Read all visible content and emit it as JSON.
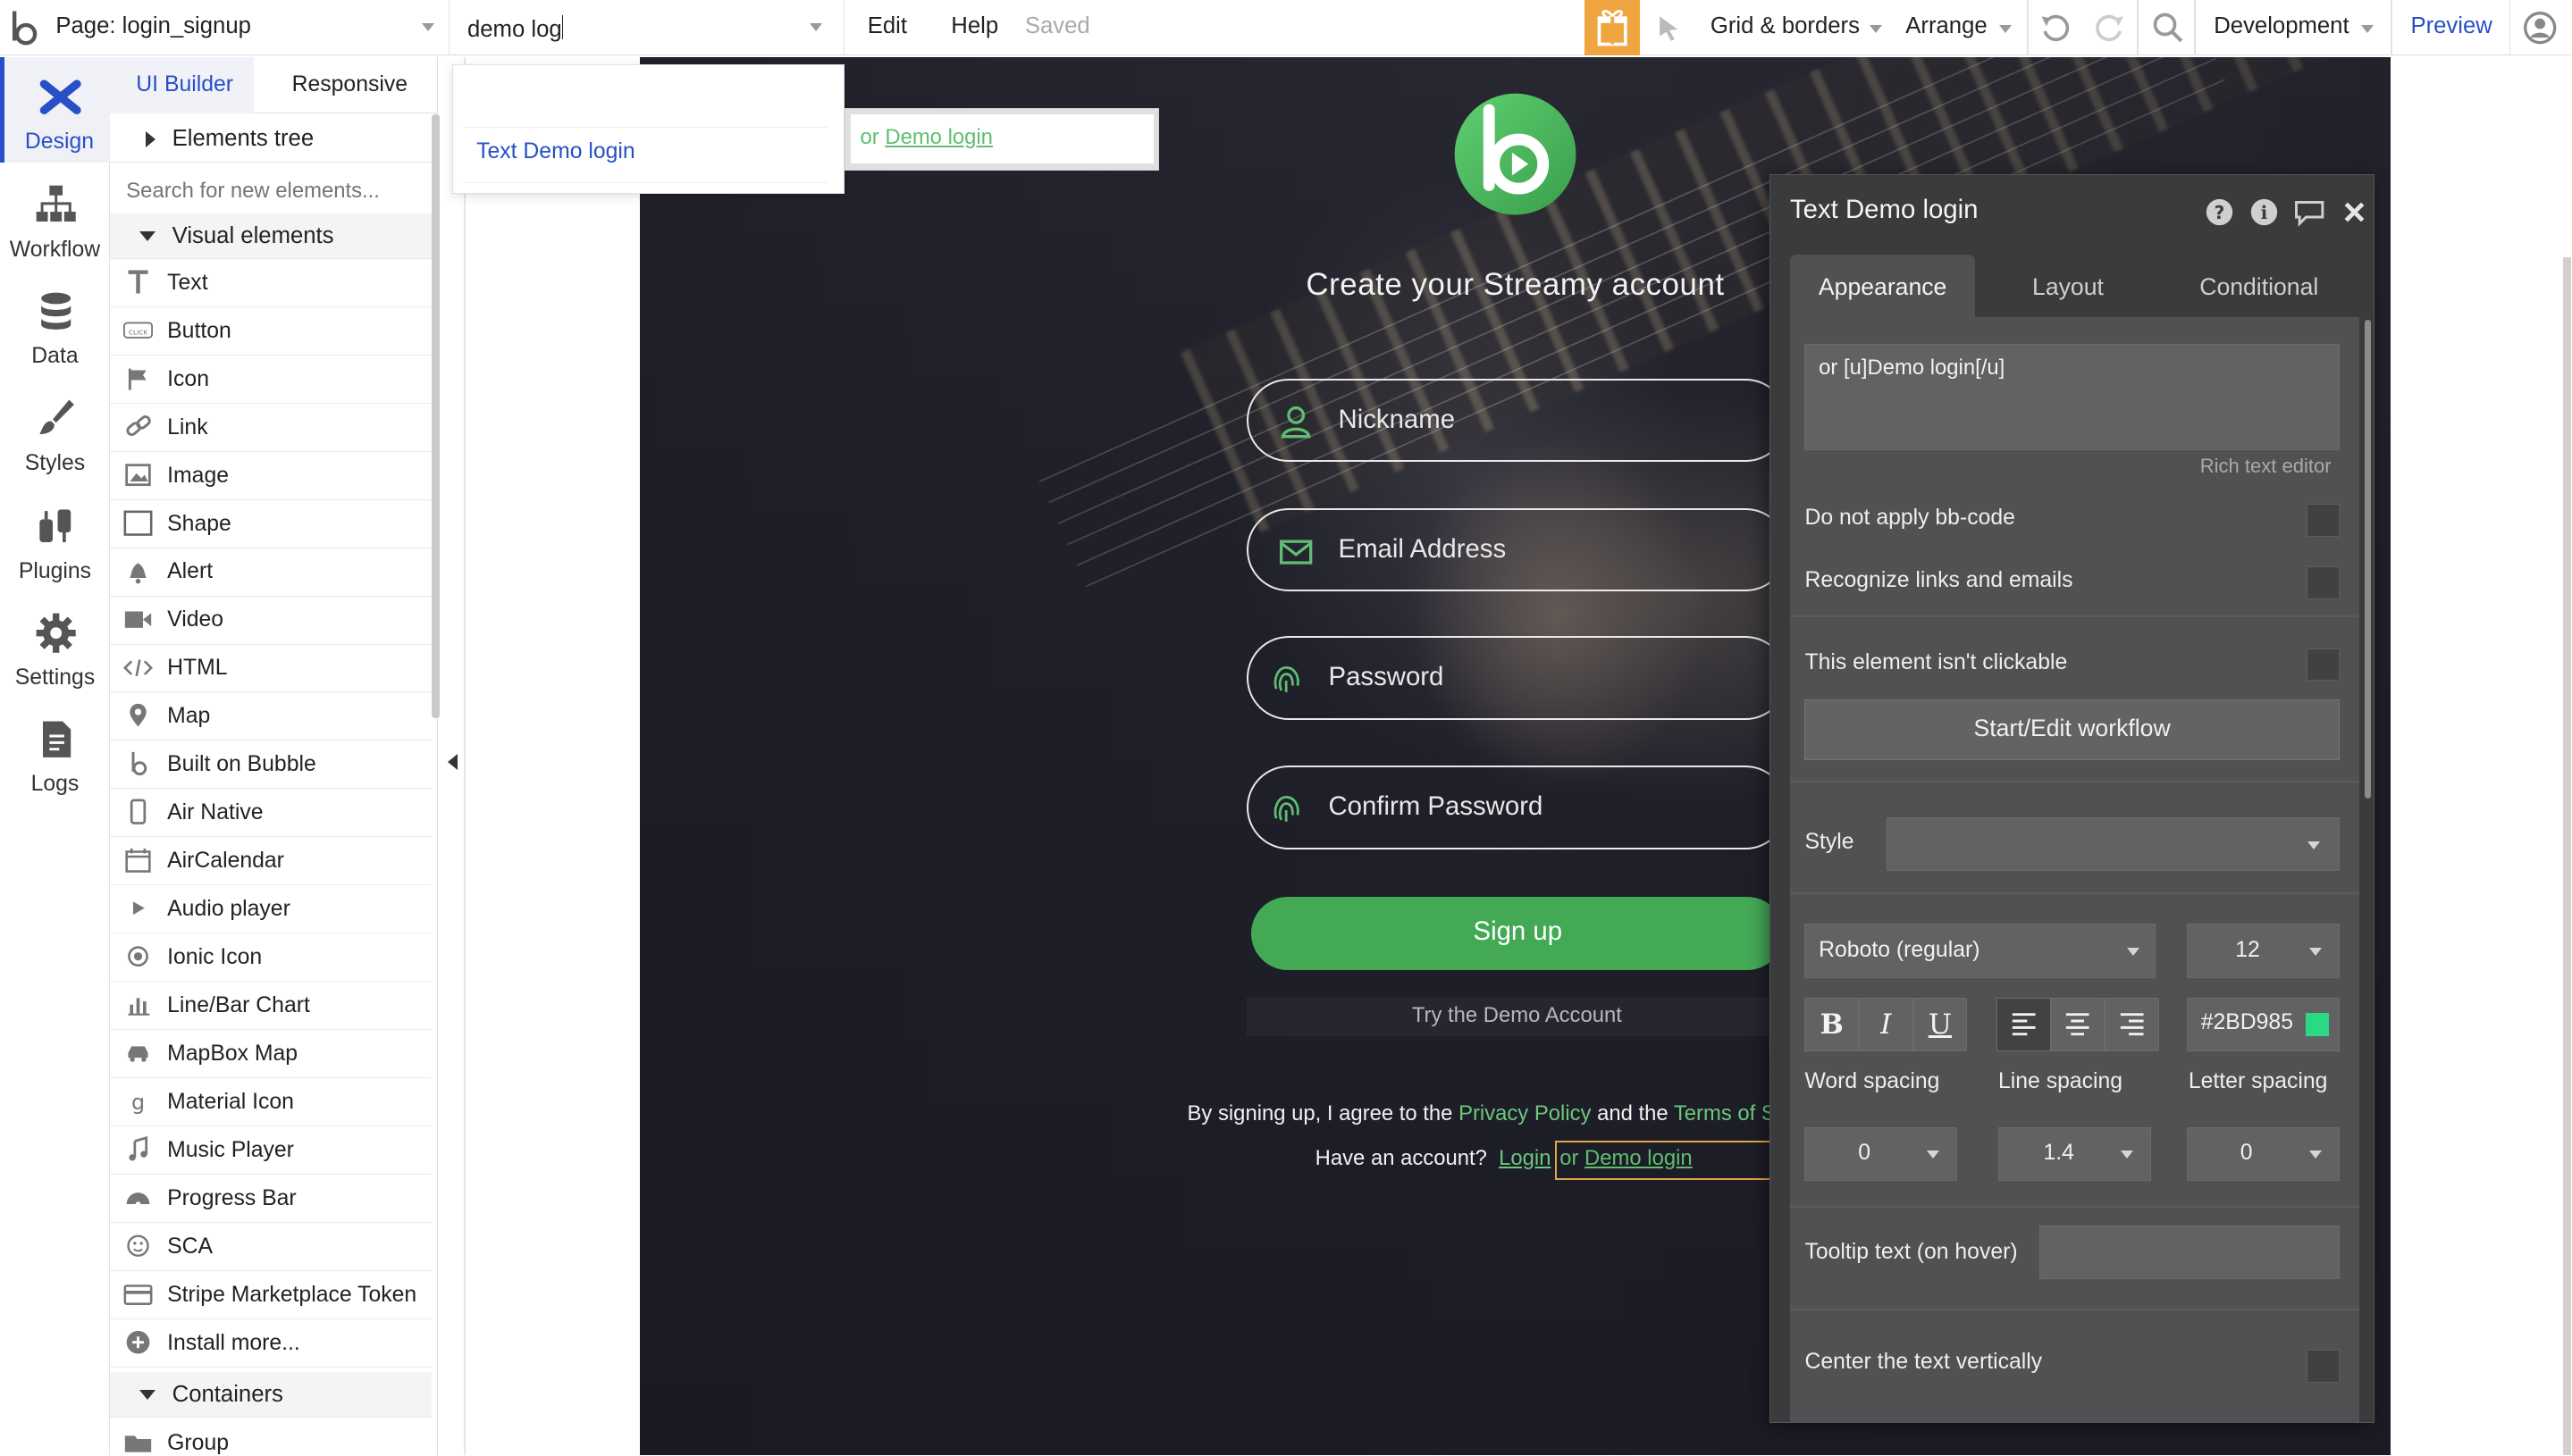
{
  "topbar": {
    "page_label": "Page: login_signup",
    "search_value": "demo log",
    "menu_edit": "Edit",
    "menu_help": "Help",
    "saved_status": "Saved",
    "grid_borders": "Grid & borders",
    "arrange": "Arrange",
    "environment": "Development",
    "preview": "Preview"
  },
  "leftnav": {
    "items": [
      {
        "label": "Design",
        "icon": "design-icon"
      },
      {
        "label": "Workflow",
        "icon": "workflow-icon"
      },
      {
        "label": "Data",
        "icon": "database-icon"
      },
      {
        "label": "Styles",
        "icon": "brush-icon"
      },
      {
        "label": "Plugins",
        "icon": "plug-icon"
      },
      {
        "label": "Settings",
        "icon": "gear-icon"
      },
      {
        "label": "Logs",
        "icon": "document-icon"
      }
    ]
  },
  "panel": {
    "tab_ui_builder": "UI Builder",
    "tab_responsive": "Responsive",
    "elements_tree": "Elements tree",
    "search_placeholder": "Search for new elements...",
    "visual_elements": "Visual elements",
    "items": [
      "Text",
      "Button",
      "Icon",
      "Link",
      "Image",
      "Shape",
      "Alert",
      "Video",
      "HTML",
      "Map",
      "Built on Bubble",
      "Air Native",
      "AirCalendar",
      "Audio player",
      "Ionic Icon",
      "Line/Bar Chart",
      "MapBox Map",
      "Material Icon",
      "Music Player",
      "Progress Bar",
      "SCA",
      "Stripe Marketplace Token",
      "Install more..."
    ],
    "containers": "Containers",
    "group": "Group",
    "button_icon_text": "CLICK"
  },
  "dropdown": {
    "result": "Text Demo login"
  },
  "hover_preview": {
    "prefix": "or ",
    "link": "Demo login"
  },
  "canvas": {
    "heading": "Create your Streamy account",
    "fields": [
      "Nickname",
      "Email Address",
      "Password",
      "Confirm Password"
    ],
    "signup": "Sign up",
    "try_demo": "Try the Demo Account",
    "terms_prefix": "By signing up, I agree to the ",
    "privacy": "Privacy Policy",
    "terms_and": " and the ",
    "terms_link": "Terms of S",
    "have_account": "Have an account?",
    "login": "Login",
    "demo_prefix": "or ",
    "demo_link": "Demo login"
  },
  "properties": {
    "title": "Text Demo login",
    "tabs": [
      "Appearance",
      "Layout",
      "Conditional"
    ],
    "content": "or [u]Demo login[/u]",
    "rich_text_editor": "Rich text editor",
    "no_bbcode": "Do not apply bb-code",
    "recognize_links": "Recognize links and emails",
    "not_clickable": "This element isn't clickable",
    "workflow_button": "Start/Edit workflow",
    "style_label": "Style",
    "font": "Roboto (regular)",
    "font_size": "12",
    "bold": "B",
    "italic": "I",
    "underline": "U",
    "color_hex": "#2BD985",
    "word_spacing_label": "Word spacing",
    "line_spacing_label": "Line spacing",
    "letter_spacing_label": "Letter spacing",
    "word_spacing": "0",
    "line_spacing": "1.4",
    "letter_spacing": "0",
    "tooltip_label": "Tooltip text (on hover)",
    "center_vert": "Center the text vertically"
  },
  "colors": {
    "accent": "#2750c7",
    "brand_green": "#43a955",
    "text_color": "#2BD985",
    "gift": "#f0a640"
  }
}
